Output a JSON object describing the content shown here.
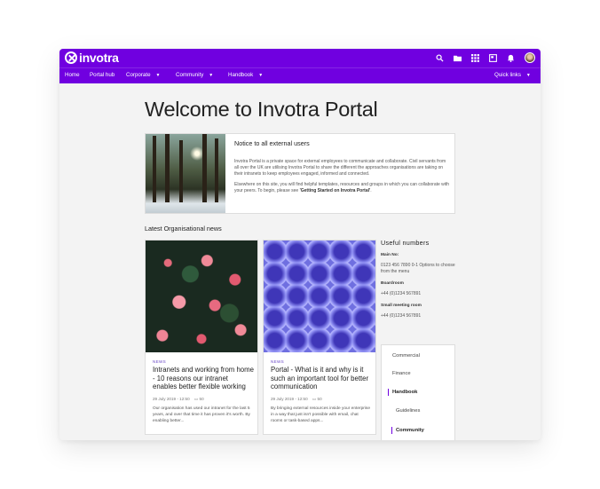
{
  "brand": {
    "logo_text": "invotra",
    "accent": "#7000e0"
  },
  "topbar": {
    "icons": [
      "search-icon",
      "folder-icon",
      "apps-grid-icon",
      "news-icon",
      "bell-icon",
      "avatar"
    ]
  },
  "nav": {
    "items": [
      {
        "label": "Home"
      },
      {
        "label": "Portal hub"
      },
      {
        "label": "Corporate",
        "has_menu": true
      },
      {
        "label": "Community",
        "has_menu": true
      },
      {
        "label": "Handbook",
        "has_menu": true
      }
    ],
    "quick_links": "Quick links"
  },
  "page": {
    "title": "Welcome to Invotra Portal"
  },
  "notice": {
    "title": "Notice to all external users",
    "p1": "Invotra Portal is a private space for external employees to communicate and collaborate. Civil servants from all over the UK are utilising Invotra Portal to share the different the approaches organisations are taking on their intranets to keep employees engaged, informed and connected.",
    "p2_text": "Elsewhere on this site, you will find helpful templates, resources and groups in which you can collaborate with your peers. To begin, please see ",
    "p2_link": "'Getting Started on Invotra Portal'",
    "p2_end": "."
  },
  "news": {
    "heading": "Latest Organisational news",
    "cards": [
      {
        "tag": "NEWS",
        "title": "Intranets and working from home - 10 reasons our intranet enables better flexible working",
        "date": "29 July 2019 - 12:50",
        "comments": "50",
        "excerpt": "Our organisation has used our intranet for the last 5 years, and over that time it has proven it's worth. By enabling better..."
      },
      {
        "tag": "NEWS",
        "title": "Portal - What is it and why is it such an important tool for better communication",
        "date": "29 July 2019 - 12:50",
        "comments": "50",
        "excerpt": "By bringing external resources inside your enterprise in a way that just isn't possible with email, chat rooms or task-based apps..."
      }
    ]
  },
  "useful": {
    "heading": "Useful numbers",
    "items": [
      {
        "label": "Main No:",
        "value": "0123 456 7890 0-1 Options to choose from the menu"
      },
      {
        "label": "Boardroom",
        "value": "+44 (0)1234 567891"
      },
      {
        "label": "Small meeting room",
        "value": "+44 (0)1234 567891"
      }
    ]
  },
  "sidenav": {
    "items": [
      {
        "label": "Commercial"
      },
      {
        "label": "Finance"
      },
      {
        "label": "Handbook"
      },
      {
        "label": "Guidelines"
      },
      {
        "label": "Community"
      }
    ]
  }
}
